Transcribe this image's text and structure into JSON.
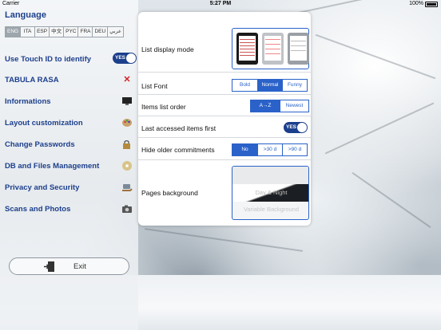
{
  "statusbar": {
    "carrier": "Carrier",
    "time": "5:27 PM",
    "battery": "100%"
  },
  "sidebar": {
    "language_title": "Language",
    "languages": [
      "ENG",
      "ITA",
      "ESP",
      "中文",
      "PYC",
      "FRA",
      "DEU",
      "عربي"
    ],
    "selected_language": "ENG",
    "items": [
      {
        "label": "Use Touch ID to identify",
        "control": "toggle",
        "toggle_text": "YES",
        "icon": ""
      },
      {
        "label": "TABULA RASA",
        "icon": "red-x-icon"
      },
      {
        "label": "Informations",
        "icon": "monitor-icon"
      },
      {
        "label": "Layout customization",
        "icon": "palette-icon"
      },
      {
        "label": "Change Passwords",
        "icon": "lock-key-icon"
      },
      {
        "label": "DB and Files Management",
        "icon": "disk-icon"
      },
      {
        "label": "Privacy and Security",
        "icon": "secure-hand-icon"
      },
      {
        "label": "Scans and Photos",
        "icon": "camera-icon"
      }
    ],
    "exit_label": "Exit"
  },
  "settings": {
    "list_display_mode": {
      "label": "List display mode"
    },
    "list_font": {
      "label": "List Font",
      "options": [
        "Bold",
        "Normal",
        "Funny"
      ],
      "selected": "Normal"
    },
    "items_list_order": {
      "label": "Items list order",
      "options": [
        "A→Z",
        "Newest"
      ],
      "selected": "A→Z"
    },
    "last_accessed_first": {
      "label": "Last accessed items first",
      "toggle_text": "YES"
    },
    "hide_older": {
      "label": "Hide older commitments",
      "options": [
        "No",
        ">30 d",
        ">90 d"
      ],
      "selected": "No"
    },
    "pages_background": {
      "label": "Pages background",
      "option_day_night": "Day & Night",
      "option_variable": "Variable Background"
    }
  },
  "colors": {
    "accent": "#2a62c9",
    "menu_text": "#1c3f8c",
    "toggle": "#1c3f8c",
    "danger": "#d22424"
  }
}
